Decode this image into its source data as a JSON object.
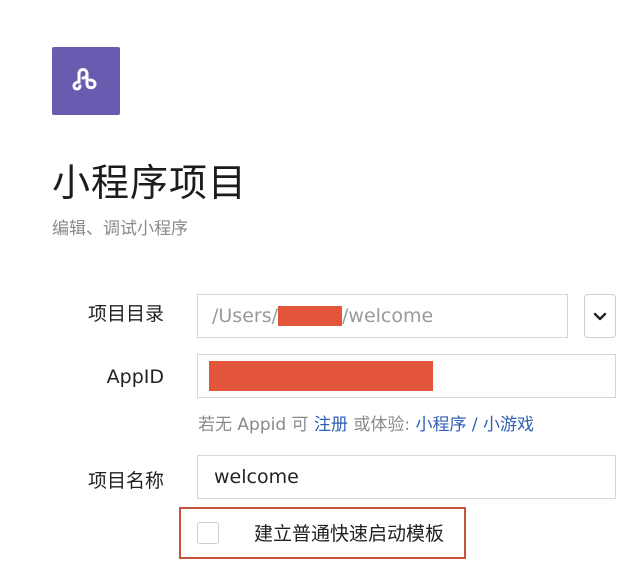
{
  "header": {
    "logo_icon": "miniprogram-logo-icon",
    "title": "小程序项目",
    "subtitle": "编辑、调试小程序"
  },
  "form": {
    "directory": {
      "label": "项目目录",
      "value_prefix": "/Users/",
      "value_suffix": "/welcome",
      "dropdown_icon": "chevron-down-icon"
    },
    "appid": {
      "label": "AppID",
      "redacted": true
    },
    "hint": {
      "prefix": "若无 Appid 可",
      "register": "注册",
      "middle": "或体验:",
      "miniprogram": "小程序",
      "separator": "/",
      "minigame": "小游戏"
    },
    "project_name": {
      "label": "项目名称",
      "value": "welcome"
    },
    "quickstart": {
      "label": "建立普通快速启动模板",
      "checked": false
    }
  },
  "colors": {
    "brand": "#6a5bb1",
    "link": "#2f5fb3",
    "redaction": "#e2553b",
    "highlight": "#c9533b"
  }
}
